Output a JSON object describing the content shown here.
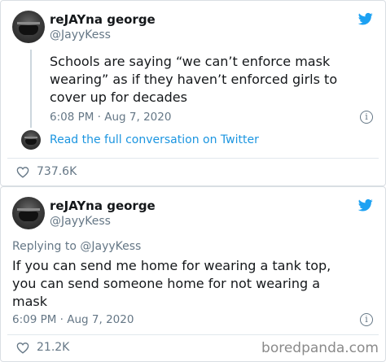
{
  "tweets": [
    {
      "name": "reJAYna george",
      "handle": "@JayyKess",
      "lines": [
        "Schools are saying “we can’t enforce mask",
        "wearing” as if they haven’t enforced girls to",
        "cover up for decades"
      ],
      "timestamp": "6:08 PM · Aug 7, 2020",
      "read_more": "Read the full conversation on Twitter",
      "likes": "737.6K"
    },
    {
      "name": "reJAYna george",
      "handle": "@JayyKess",
      "replying_to": "Replying to @JayyKess",
      "lines": [
        "If you can send me home for wearing a tank top,",
        "you can send someone home for not wearing a",
        "mask"
      ],
      "timestamp": "6:09 PM · Aug 7, 2020",
      "likes": "21.2K"
    }
  ],
  "icons": {
    "twitter": "twitter-bird-icon",
    "info": "info-icon",
    "like": "heart-icon"
  },
  "watermark": "boredpanda.com",
  "colors": {
    "twitter_blue": "#1da1f2",
    "link_blue": "#1b95e0",
    "muted": "#657786",
    "text": "#14171a"
  }
}
